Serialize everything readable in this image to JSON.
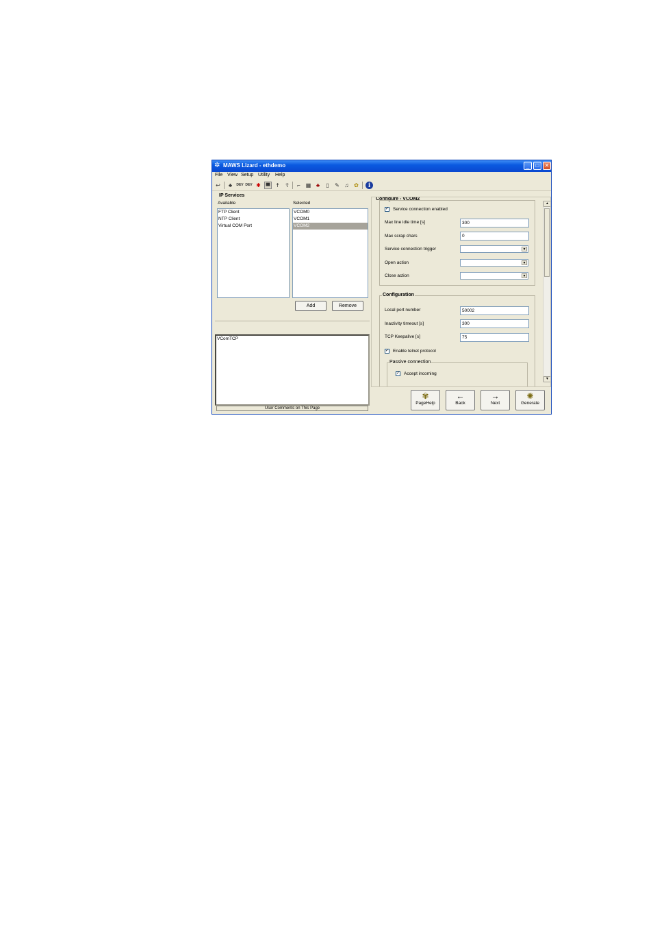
{
  "window": {
    "title": "MAWS Lizard - ethdemo",
    "app_icon": "lizard-icon",
    "controls": [
      "minimize",
      "maximize",
      "close"
    ]
  },
  "menu": [
    "File",
    "View",
    "Setup",
    "Utility",
    "Help"
  ],
  "toolbar_icons": [
    "undo-icon",
    "network-icon",
    "dev-icon",
    "dev-icon",
    "cross-icon",
    "sensor-icon",
    "walk-icon",
    "run-icon",
    "flag-icon",
    "grid-icon",
    "tree-icon",
    "page-icon",
    "pen-icon",
    "bell-icon",
    "gear-icon",
    "info-icon"
  ],
  "ip_services": {
    "title": "IP Services",
    "available_label": "Available",
    "selected_label": "Selected",
    "available": [
      "FTP Client",
      "NTP Client",
      "Virtual COM Port"
    ],
    "selected": [
      "VCOM0",
      "VCOM1",
      "VCOM2"
    ],
    "selected_index": 2,
    "add_label": "Add",
    "remove_label": "Remove"
  },
  "comments": {
    "text": "VComTCP",
    "footer": "User Comments on This Page"
  },
  "configure": {
    "title": "Configure - VCOM2",
    "service_enabled_label": "Service connection enabled",
    "service_enabled": true,
    "max_idle_label": "Max line idle time [s]",
    "max_idle_value": "300",
    "max_scrap_label": "Max scrap chars",
    "max_scrap_value": "0",
    "trigger_label": "Service connection trigger",
    "trigger_value": "",
    "open_action_label": "Open action",
    "open_action_value": "",
    "close_action_label": "Close action",
    "close_action_value": ""
  },
  "configuration": {
    "title": "Configuration",
    "local_port_label": "Local port number",
    "local_port_value": "50002",
    "inactivity_label": "Inactivity timeout [s]",
    "inactivity_value": "300",
    "keepalive_label": "TCP Keepalive [s]",
    "keepalive_value": "75",
    "telnet_label": "Enable telnet protocol",
    "telnet_checked": true,
    "passive_title": "Passive connection",
    "accept_label": "Accept incoming",
    "accept_checked": true
  },
  "nav": {
    "pagehelp": "PageHelp",
    "back": "Back",
    "next": "Next",
    "generate": "Generate"
  }
}
